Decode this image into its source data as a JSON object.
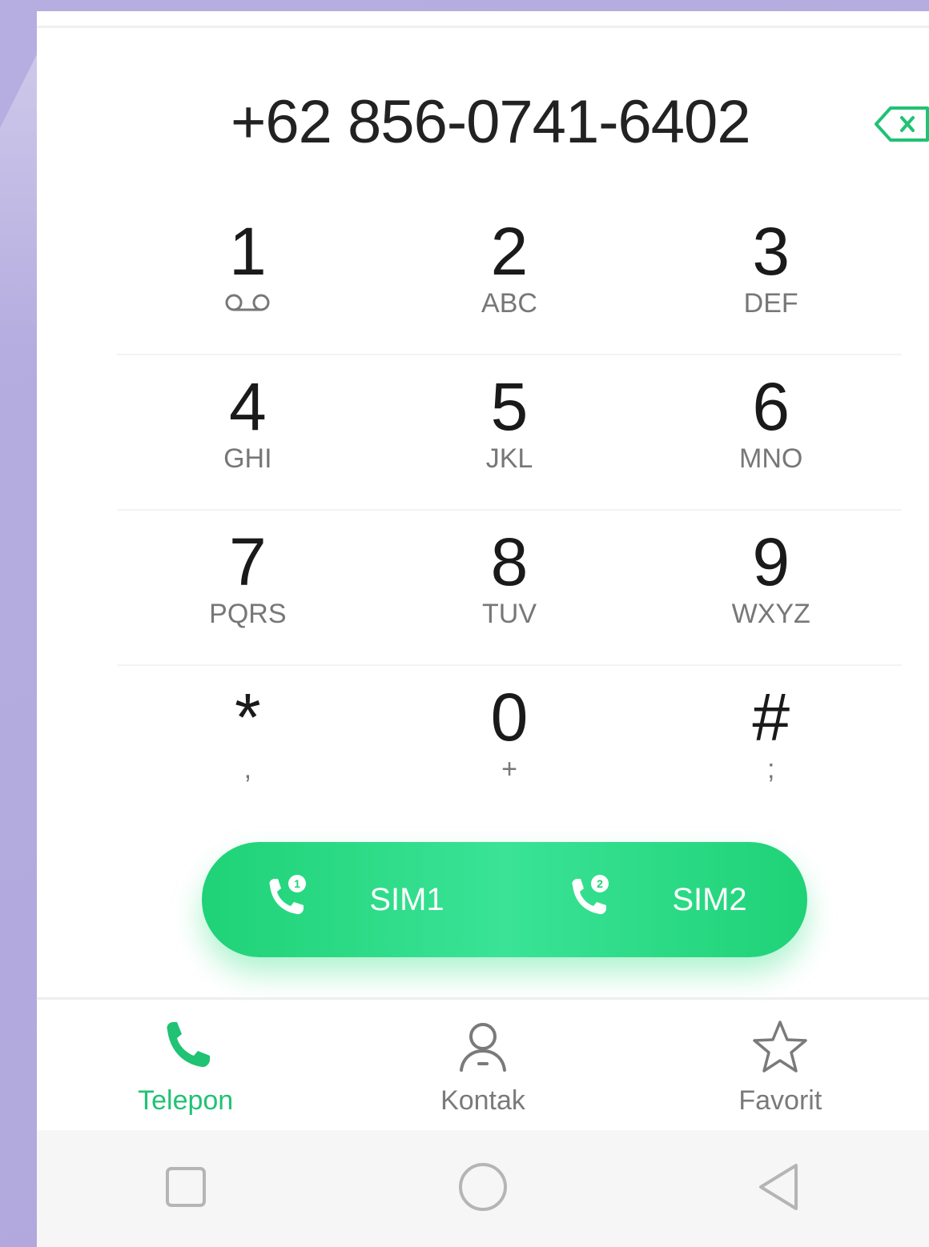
{
  "dialer": {
    "number": "+62 856-0741-6402"
  },
  "keypad": {
    "rows": [
      [
        {
          "digit": "1",
          "letters": ""
        },
        {
          "digit": "2",
          "letters": "ABC"
        },
        {
          "digit": "3",
          "letters": "DEF"
        }
      ],
      [
        {
          "digit": "4",
          "letters": "GHI"
        },
        {
          "digit": "5",
          "letters": "JKL"
        },
        {
          "digit": "6",
          "letters": "MNO"
        }
      ],
      [
        {
          "digit": "7",
          "letters": "PQRS"
        },
        {
          "digit": "8",
          "letters": "TUV"
        },
        {
          "digit": "9",
          "letters": "WXYZ"
        }
      ],
      [
        {
          "digit": "*",
          "letters": ","
        },
        {
          "digit": "0",
          "letters": "+"
        },
        {
          "digit": "#",
          "letters": ";"
        }
      ]
    ]
  },
  "call_buttons": {
    "sim1_label": "SIM1",
    "sim2_label": "SIM2",
    "sim1_badge": "1",
    "sim2_badge": "2"
  },
  "tabs": [
    {
      "label": "Telepon",
      "icon": "phone-icon",
      "active": true
    },
    {
      "label": "Kontak",
      "icon": "person-icon",
      "active": false
    },
    {
      "label": "Favorit",
      "icon": "star-icon",
      "active": false
    }
  ],
  "nav": [
    "recents-square-icon",
    "home-circle-icon",
    "back-triangle-icon"
  ],
  "colors": {
    "accent": "#20c274",
    "call_bar": "#1fd277",
    "background": "#b3aade"
  }
}
